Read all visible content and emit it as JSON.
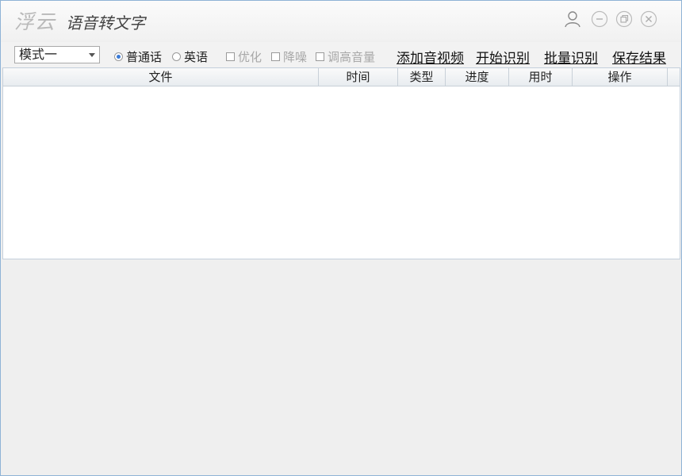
{
  "app": {
    "logo": "浮云",
    "title": "语音转文字"
  },
  "window_controls": {
    "user": "user-icon",
    "minimize": "minimize-icon",
    "maximize": "restore-icon",
    "close": "close-icon"
  },
  "toolbar": {
    "mode_value": "模式一",
    "language_options": [
      {
        "label": "普通话",
        "selected": true
      },
      {
        "label": "英语",
        "selected": false
      }
    ],
    "checkboxes": [
      {
        "label": "优化",
        "checked": false,
        "enabled": false
      },
      {
        "label": "降噪",
        "checked": false,
        "enabled": false
      },
      {
        "label": "调高音量",
        "checked": false,
        "enabled": false
      }
    ],
    "actions": {
      "add_media": "添加音视频",
      "start": "开始识别",
      "batch": "批量识别",
      "save": "保存结果"
    }
  },
  "table": {
    "columns": [
      "文件",
      "时间",
      "类型",
      "进度",
      "用时",
      "操作"
    ],
    "rows": []
  },
  "colors": {
    "accent": "#3b7bd6",
    "border": "#8fb3d6"
  }
}
